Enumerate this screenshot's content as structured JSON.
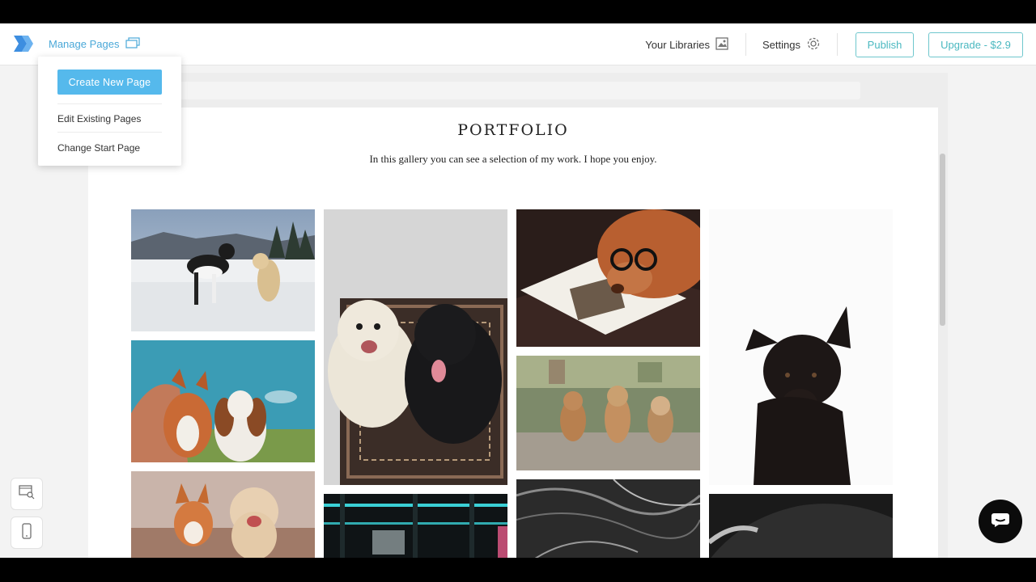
{
  "header": {
    "manage_pages_label": "Manage Pages",
    "libraries_label": "Your Libraries",
    "settings_label": "Settings",
    "publish_label": "Publish",
    "upgrade_label": "Upgrade - $2.9"
  },
  "dropdown": {
    "create_label": "Create New Page",
    "edit_label": "Edit Existing Pages",
    "change_start_label": "Change Start Page"
  },
  "page": {
    "title": "PORTFOLIO",
    "subtitle": "In this gallery you can see a selection of my work. I hope you enjoy."
  },
  "gallery": [
    {
      "name": "husky-snow-photo",
      "desc": "two dogs playing in snow"
    },
    {
      "name": "doodle-and-black-lab-photo",
      "desc": "doodle and black lab on rug"
    },
    {
      "name": "dog-with-glasses-photo",
      "desc": "dog wearing glasses reading magazine"
    },
    {
      "name": "black-shepherd-photo",
      "desc": "black dog sitting"
    },
    {
      "name": "corgi-and-spaniel-photo",
      "desc": "two dogs under blue sky"
    },
    {
      "name": "three-puppies-photo",
      "desc": "three puppies on road"
    },
    {
      "name": "corgi-and-poodle-photo",
      "desc": "corgi and poodle"
    },
    {
      "name": "neon-shelf-photo",
      "desc": "neon shelves"
    },
    {
      "name": "black-white-fur-photo",
      "desc": "black and white fur close-up"
    },
    {
      "name": "dark-dog-photo",
      "desc": "dark dog profile"
    }
  ],
  "colors": {
    "accent": "#55b9ec",
    "link": "#4aa8d8",
    "outline": "#6fc7cd"
  }
}
